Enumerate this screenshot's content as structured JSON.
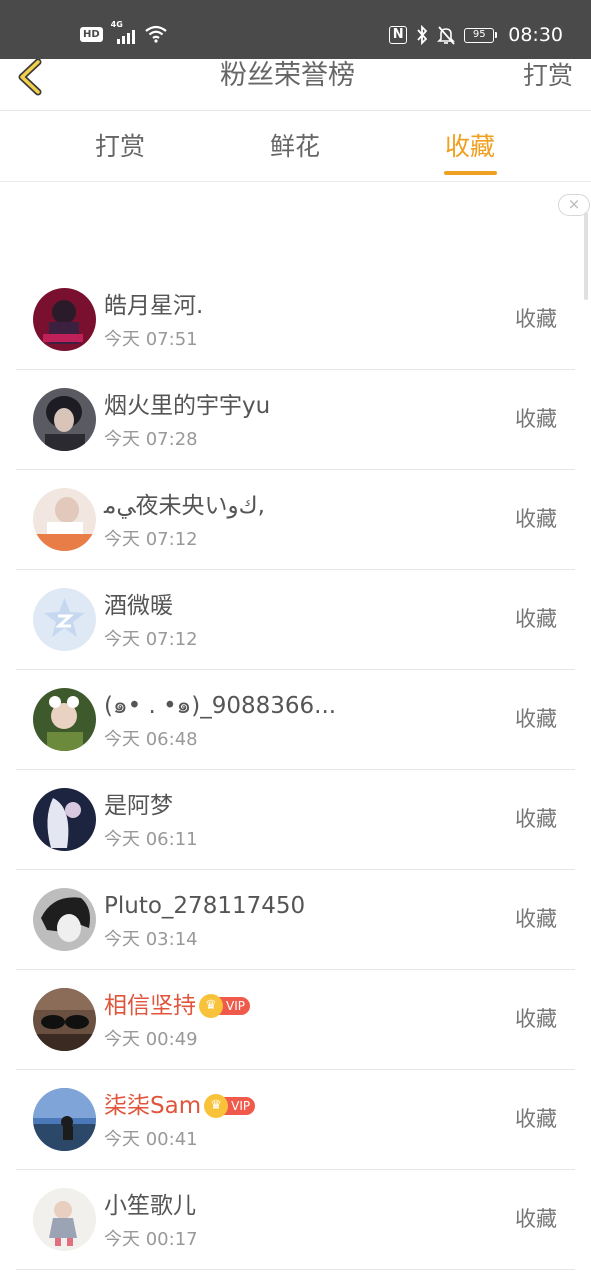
{
  "status_bar": {
    "hd": "HD",
    "network": "4G",
    "battery": "95",
    "time": "08:30"
  },
  "nav": {
    "title": "粉丝荣誉榜",
    "right": "打赏"
  },
  "tabs": [
    {
      "label": "打赏",
      "active": false
    },
    {
      "label": "鲜花",
      "active": false
    },
    {
      "label": "收藏",
      "active": true
    }
  ],
  "ad": {
    "close": "×"
  },
  "fans": [
    {
      "name": "皓月星河.",
      "time": "今天 07:51",
      "action": "收藏",
      "vip": false
    },
    {
      "name": "烟火里的宇宇yu",
      "time": "今天 07:28",
      "action": "收藏",
      "vip": false
    },
    {
      "name": "ﻲﻣ夜未央いكﻭ,",
      "time": "今天 07:12",
      "action": "收藏",
      "vip": false
    },
    {
      "name": "酒微暖",
      "time": "今天 07:12",
      "action": "收藏",
      "vip": false
    },
    {
      "name": "(๑• . •๑)_9088366...",
      "time": "今天 06:48",
      "action": "收藏",
      "vip": false
    },
    {
      "name": "是阿梦",
      "time": "今天 06:11",
      "action": "收藏",
      "vip": false
    },
    {
      "name": "Pluto_278117450",
      "time": "今天 03:14",
      "action": "收藏",
      "vip": false
    },
    {
      "name": "相信坚持",
      "time": "今天 00:49",
      "action": "收藏",
      "vip": true,
      "vip_label": "VIP"
    },
    {
      "name": "柒柒Sam",
      "time": "今天 00:41",
      "action": "收藏",
      "vip": true,
      "vip_label": "VIP"
    },
    {
      "name": "小笙歌儿",
      "time": "今天 00:17",
      "action": "收藏",
      "vip": false
    }
  ],
  "colors": {
    "accent": "#f0a020",
    "vip_name": "#e0553b",
    "status_bar": "#4a4a4a"
  }
}
